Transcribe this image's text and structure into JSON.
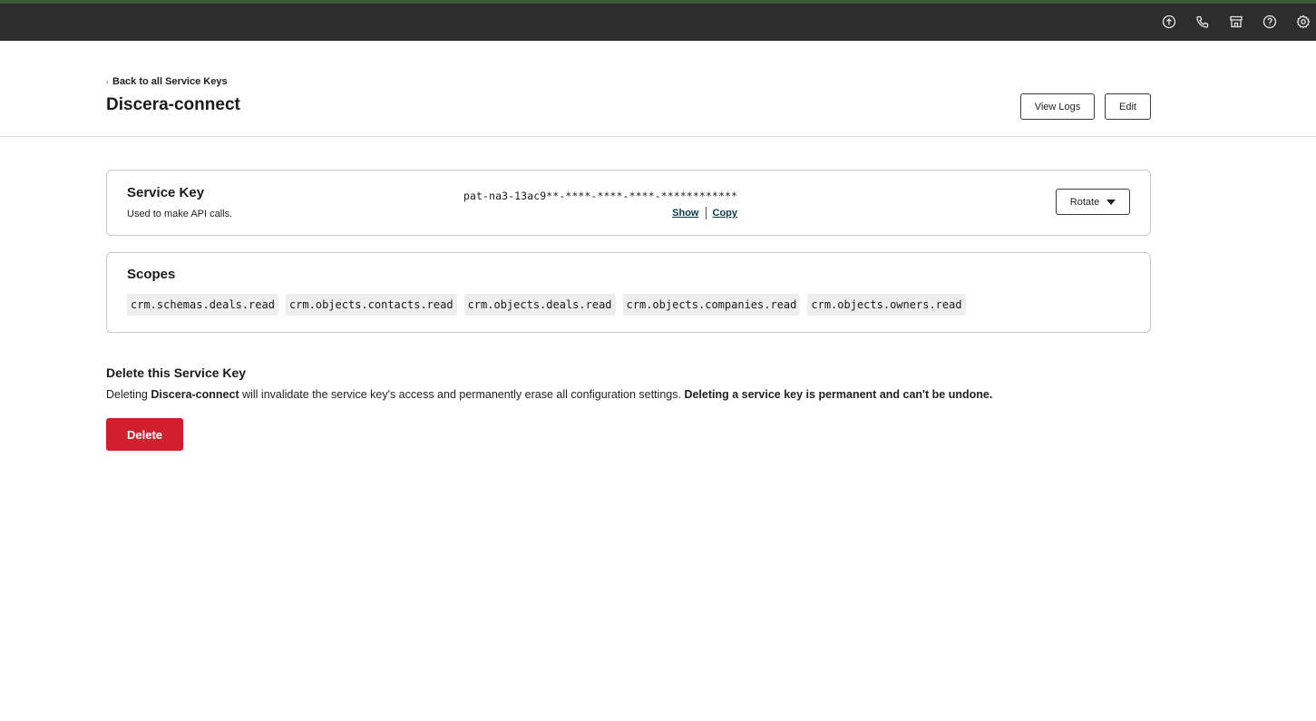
{
  "topbar": {
    "icons": [
      "upgrade-icon",
      "phone-icon",
      "marketplace-icon",
      "help-icon",
      "settings-icon"
    ]
  },
  "header": {
    "back_link": "Back to all Service Keys",
    "title": "Discera-connect",
    "view_logs_label": "View Logs",
    "edit_label": "Edit"
  },
  "service_key": {
    "title": "Service Key",
    "subtitle": "Used to make API calls.",
    "masked_value": "pat-na3-13ac9**-****-****-****-************",
    "show_label": "Show",
    "copy_label": "Copy",
    "rotate_label": "Rotate"
  },
  "scopes": {
    "title": "Scopes",
    "items": [
      "crm.schemas.deals.read",
      "crm.objects.contacts.read",
      "crm.objects.deals.read",
      "crm.objects.companies.read",
      "crm.objects.owners.read"
    ]
  },
  "delete_section": {
    "title": "Delete this Service Key",
    "desc_prefix": "Deleting ",
    "desc_name": "Discera-connect",
    "desc_middle": " will invalidate the service key's access and permanently erase all configuration settings. ",
    "desc_warning": "Deleting a service key is permanent and can't be undone.",
    "button_label": "Delete"
  },
  "colors": {
    "topbar_bg": "#2d2d2d",
    "topbar_accent": "#3c5a35",
    "delete_red": "#d0202e",
    "link": "#0b3b4a"
  }
}
